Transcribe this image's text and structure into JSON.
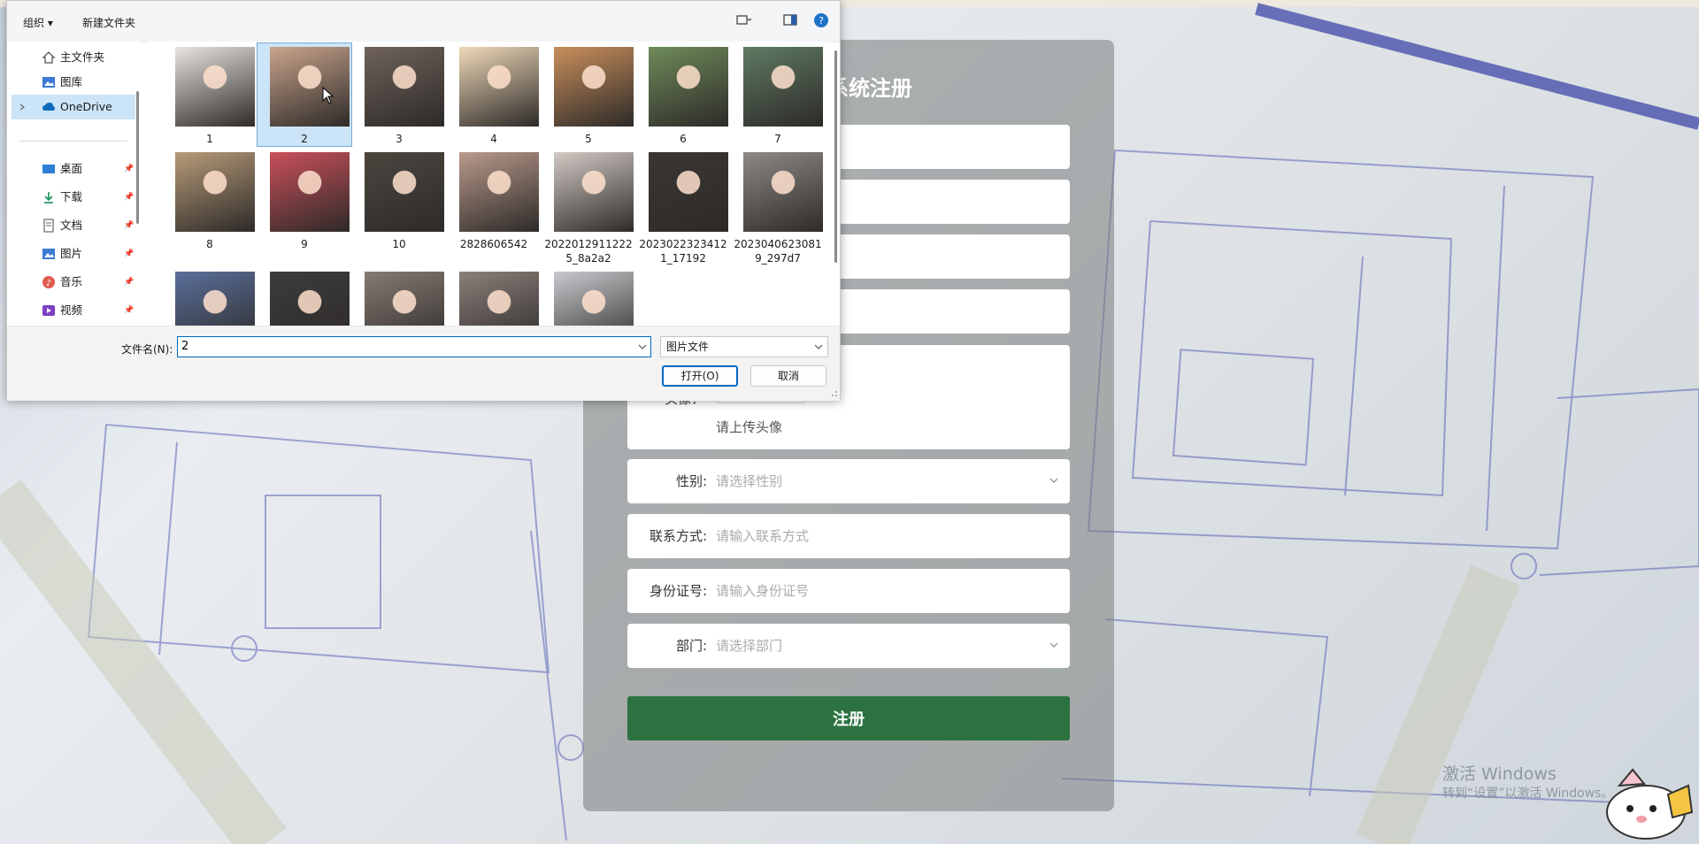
{
  "register": {
    "title": "系统注册",
    "avatar": {
      "label": "头像：",
      "hint": "请上传头像"
    },
    "fields": [
      {
        "key": "gender",
        "label": "性别:",
        "placeholder": "请选择性别",
        "select": true
      },
      {
        "key": "contact",
        "label": "联系方式:",
        "placeholder": "请输入联系方式",
        "select": false
      },
      {
        "key": "id_card",
        "label": "身份证号:",
        "placeholder": "请输入身份证号",
        "select": false
      },
      {
        "key": "department",
        "label": "部门:",
        "placeholder": "请选择部门",
        "select": true
      }
    ],
    "submit_label": "注册"
  },
  "watermark": {
    "line1": "激活 Windows",
    "line2": "转到“设置”以激活 Windows。"
  },
  "dialog": {
    "toolbar": {
      "organize_label": "组织 ▾",
      "new_folder_label": "新建文件夹"
    },
    "nav": {
      "items": [
        {
          "label": "主文件夹",
          "icon": "home-icon",
          "pinned": false
        },
        {
          "label": "图库",
          "icon": "gallery-icon",
          "pinned": false
        },
        {
          "label": "OneDrive",
          "icon": "cloud-icon",
          "pinned": false,
          "selected": true
        },
        {
          "label": "桌面",
          "icon": "desktop-icon",
          "pinned": true
        },
        {
          "label": "下载",
          "icon": "download-icon",
          "pinned": true
        },
        {
          "label": "文档",
          "icon": "document-icon",
          "pinned": true
        },
        {
          "label": "图片",
          "icon": "pictures-icon",
          "pinned": true
        },
        {
          "label": "音乐",
          "icon": "music-icon",
          "pinned": true
        },
        {
          "label": "视频",
          "icon": "video-icon",
          "pinned": true
        }
      ]
    },
    "files": [
      {
        "name": "1",
        "color": "#e9e4e0"
      },
      {
        "name": "2",
        "color": "#c9a48c",
        "selected": true
      },
      {
        "name": "3",
        "color": "#6f625b"
      },
      {
        "name": "4",
        "color": "#efd9b9"
      },
      {
        "name": "5",
        "color": "#c98f5c"
      },
      {
        "name": "6",
        "color": "#6f8b5a"
      },
      {
        "name": "7",
        "color": "#5f7a63"
      },
      {
        "name": "8",
        "color": "#b79b79"
      },
      {
        "name": "9",
        "color": "#c9505a"
      },
      {
        "name": "10",
        "color": "#4c4640"
      },
      {
        "name": "2828606542",
        "color": "#b99a8c"
      },
      {
        "name": "20220129112225_8a2a2",
        "color": "#d3cac5"
      },
      {
        "name": "20230223234121_17192",
        "color": "#3a3634"
      },
      {
        "name": "20230406230819_297d7",
        "color": "#8f8a86"
      },
      {
        "name": "",
        "color": "#5a6f9a"
      },
      {
        "name": "",
        "color": "#3d3b3c"
      },
      {
        "name": "",
        "color": "#867b74"
      },
      {
        "name": "",
        "color": "#8a7f7a"
      },
      {
        "name": "",
        "color": "#c9cacf"
      }
    ],
    "filename_label": "文件名(N):",
    "filename_value": "2",
    "filetype_value": "图片文件",
    "open_label": "打开(O)",
    "cancel_label": "取消"
  },
  "colors": {
    "accent": "#0067c0",
    "selection": "#cce4f7",
    "register_button": "#2c7240"
  }
}
